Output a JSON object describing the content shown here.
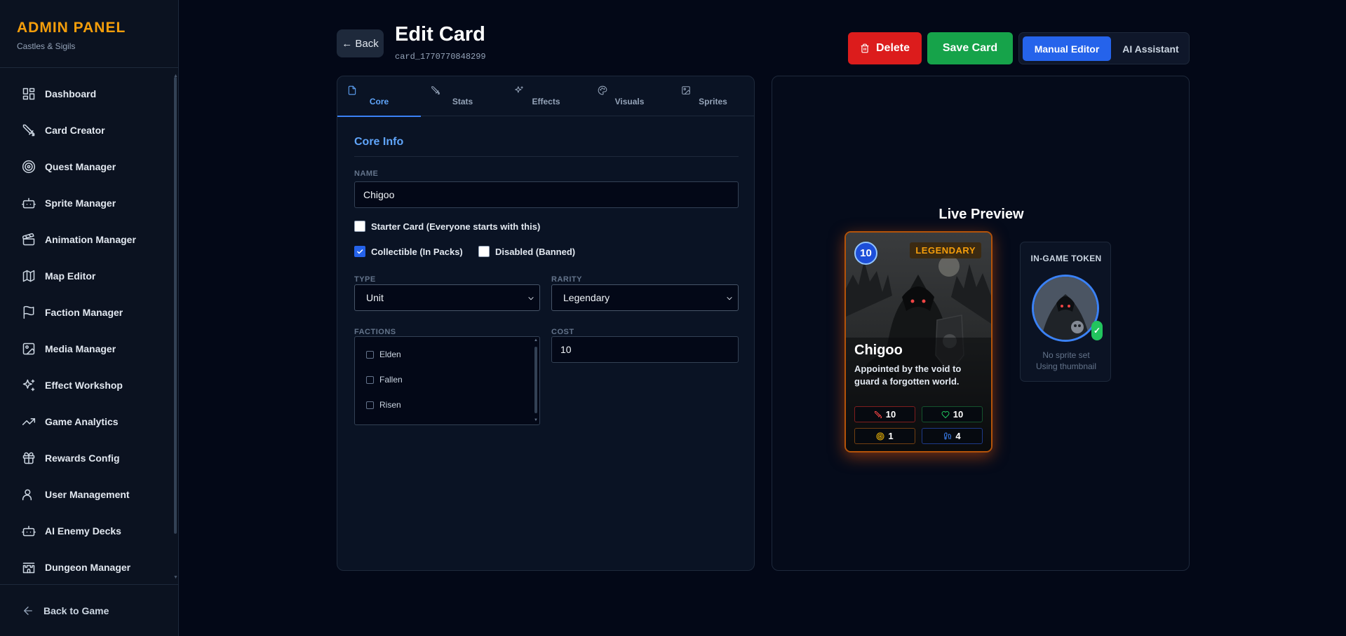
{
  "brand": {
    "title": "ADMIN PANEL",
    "subtitle": "Castles & Sigils"
  },
  "sidebar": {
    "items": [
      {
        "label": "Dashboard",
        "icon": "dashboard-icon"
      },
      {
        "label": "Card Creator",
        "icon": "swords-icon"
      },
      {
        "label": "Quest Manager",
        "icon": "target-icon"
      },
      {
        "label": "Sprite Manager",
        "icon": "bot-icon"
      },
      {
        "label": "Animation Manager",
        "icon": "clapperboard-icon"
      },
      {
        "label": "Map Editor",
        "icon": "map-icon"
      },
      {
        "label": "Faction Manager",
        "icon": "flag-icon"
      },
      {
        "label": "Media Manager",
        "icon": "image-icon"
      },
      {
        "label": "Effect Workshop",
        "icon": "sparkles-icon"
      },
      {
        "label": "Game Analytics",
        "icon": "trending-up-icon"
      },
      {
        "label": "Rewards Config",
        "icon": "gift-icon"
      },
      {
        "label": "User Management",
        "icon": "users-icon"
      },
      {
        "label": "AI Enemy Decks",
        "icon": "bot-icon"
      },
      {
        "label": "Dungeon Manager",
        "icon": "castle-icon"
      }
    ],
    "footer": "Back to Game"
  },
  "header": {
    "back_label": "← Back",
    "title": "Edit Card",
    "card_id": "card_1770770848299",
    "delete_label": "Delete",
    "save_label": "Save Card",
    "mode_manual": "Manual Editor",
    "mode_ai": "AI Assistant",
    "active_mode": "Manual Editor"
  },
  "tabs": [
    {
      "label": "Core",
      "icon": "file-icon",
      "active": true
    },
    {
      "label": "Stats",
      "icon": "swords-icon",
      "active": false
    },
    {
      "label": "Effects",
      "icon": "sparkles-icon",
      "active": false
    },
    {
      "label": "Visuals",
      "icon": "palette-icon",
      "active": false
    },
    {
      "label": "Sprites",
      "icon": "image-icon",
      "active": false
    }
  ],
  "core": {
    "section_title": "Core Info",
    "name_label": "NAME",
    "name_value": "Chigoo",
    "starter_label": "Starter Card (Everyone starts with this)",
    "starter_checked": false,
    "collectible_label": "Collectible (In Packs)",
    "collectible_checked": true,
    "disabled_label": "Disabled (Banned)",
    "disabled_checked": false,
    "type_label": "TYPE",
    "type_value": "Unit",
    "rarity_label": "RARITY",
    "rarity_value": "Legendary",
    "factions_label": "FACTIONS",
    "factions": [
      {
        "name": "Elden",
        "checked": false
      },
      {
        "name": "Fallen",
        "checked": false
      },
      {
        "name": "Risen",
        "checked": false
      }
    ],
    "cost_label": "COST",
    "cost_value": "10"
  },
  "preview": {
    "title": "Live Preview",
    "card": {
      "cost": "10",
      "rarity": "LEGENDARY",
      "name": "Chigoo",
      "description": "Appointed by the void to guard a forgotten world.",
      "attack": "10",
      "health": "10",
      "range": "1",
      "movement": "4"
    },
    "token": {
      "label": "IN-GAME TOKEN",
      "check": "✓",
      "note_line1": "No sprite set",
      "note_line2": "Using thumbnail"
    }
  },
  "colors": {
    "accent": "#2563eb",
    "brand": "#f59e0b",
    "delete": "#dc1c1c",
    "save": "#16a34a",
    "legendary": "#f59e0b"
  }
}
